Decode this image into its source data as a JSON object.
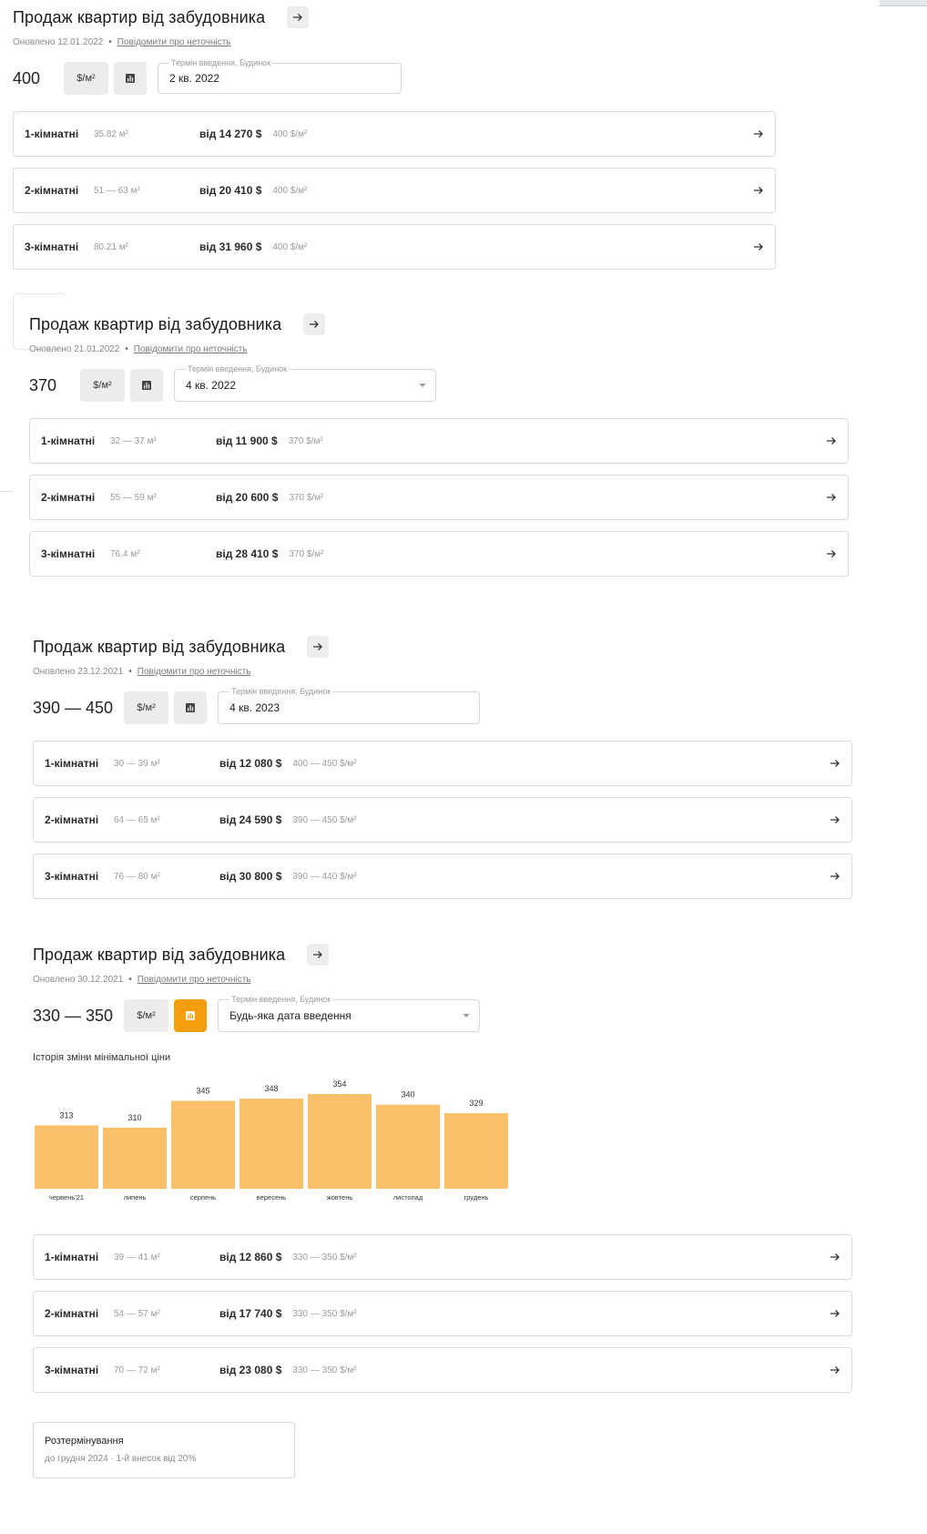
{
  "listings": [
    {
      "title": "Продаж квартир від забудовника",
      "updated": "Оновлено 12.01.2022",
      "report_link": "Повідомити про неточність",
      "price": "400",
      "unit": "$/м²",
      "field_label": "Термін введення, Будинок",
      "field_value": "2 кв. 2022",
      "rows": [
        {
          "rooms": "1-кімнатні",
          "area": "35.82 м²",
          "from": "від 14 270 $",
          "ppm": "400 $/м²"
        },
        {
          "rooms": "2-кімнатні",
          "area": "51 — 63 м²",
          "from": "від 20 410 $",
          "ppm": "400 $/м²"
        },
        {
          "rooms": "3-кімнатні",
          "area": "80.21 м²",
          "from": "від 31 960 $",
          "ppm": "400 $/м²"
        }
      ]
    },
    {
      "title": "Продаж квартир від забудовника",
      "updated": "Оновлено 21.01.2022",
      "report_link": "Повідомити про неточність",
      "price": "370",
      "unit": "$/м²",
      "field_label": "Термін введення, Будинок",
      "field_value": "4 кв. 2022",
      "rows": [
        {
          "rooms": "1-кімнатні",
          "area": "32 — 37 м²",
          "from": "від 11 900 $",
          "ppm": "370 $/м²"
        },
        {
          "rooms": "2-кімнатні",
          "area": "55 — 59 м²",
          "from": "від 20 600 $",
          "ppm": "370 $/м²"
        },
        {
          "rooms": "3-кімнатні",
          "area": "76.4 м²",
          "from": "від 28 410 $",
          "ppm": "370 $/м²"
        }
      ]
    },
    {
      "title": "Продаж квартир від забудовника",
      "updated": "Оновлено 23.12.2021",
      "report_link": "Повідомити про неточність",
      "price": "390 — 450",
      "unit": "$/м²",
      "field_label": "Термін введення, Будинок",
      "field_value": "4 кв. 2023",
      "rows": [
        {
          "rooms": "1-кімнатні",
          "area": "30 — 39 м²",
          "from": "від 12 080 $",
          "ppm": "400 — 450 $/м²"
        },
        {
          "rooms": "2-кімнатні",
          "area": "64 — 65 м²",
          "from": "від 24 590 $",
          "ppm": "390 — 450 $/м²"
        },
        {
          "rooms": "3-кімнатні",
          "area": "76 — 80 м²",
          "from": "від 30 800 $",
          "ppm": "390 — 440 $/м²"
        }
      ]
    },
    {
      "title": "Продаж квартир від забудовника",
      "updated": "Оновлено 30.12.2021",
      "report_link": "Повідомити про неточність",
      "price": "330 — 350",
      "unit": "$/м²",
      "field_label": "Термін введення, Будинок",
      "field_value": "Будь-яка дата введення",
      "history_title": "Історія зміни мінімальної ціни",
      "rows": [
        {
          "rooms": "1-кімнатні",
          "area": "39 — 41 м²",
          "from": "від 12 860 $",
          "ppm": "330 — 350 $/м²"
        },
        {
          "rooms": "2-кімнатні",
          "area": "54 — 57 м²",
          "from": "від 17 740 $",
          "ppm": "330 — 350 $/м²"
        },
        {
          "rooms": "3-кімнатні",
          "area": "70 — 72 м²",
          "from": "від 23 080 $",
          "ppm": "330 — 350 $/м²"
        }
      ],
      "installment": {
        "title": "Розтермінування",
        "subtitle": "до грудня 2024 · 1-й внесок від 20%"
      }
    }
  ],
  "colors": {
    "bar": "#fac16a",
    "accent": "#f59e0b"
  },
  "icons": {
    "title_arrow": "arrow-right-icon",
    "row_arrow": "arrow-right-icon",
    "chart_toggle": "bar-chart-icon",
    "dropdown": "chevron-down-icon"
  },
  "chart_data": {
    "type": "bar",
    "title": "Історія зміни мінімальної ціни",
    "categories": [
      "червень'21",
      "липень",
      "серпень",
      "вересень",
      "жовтень",
      "листопад",
      "грудень"
    ],
    "values": [
      313,
      310,
      345,
      348,
      354,
      340,
      329
    ],
    "ylim": [
      0,
      354
    ],
    "grid": false,
    "legend": "none"
  }
}
